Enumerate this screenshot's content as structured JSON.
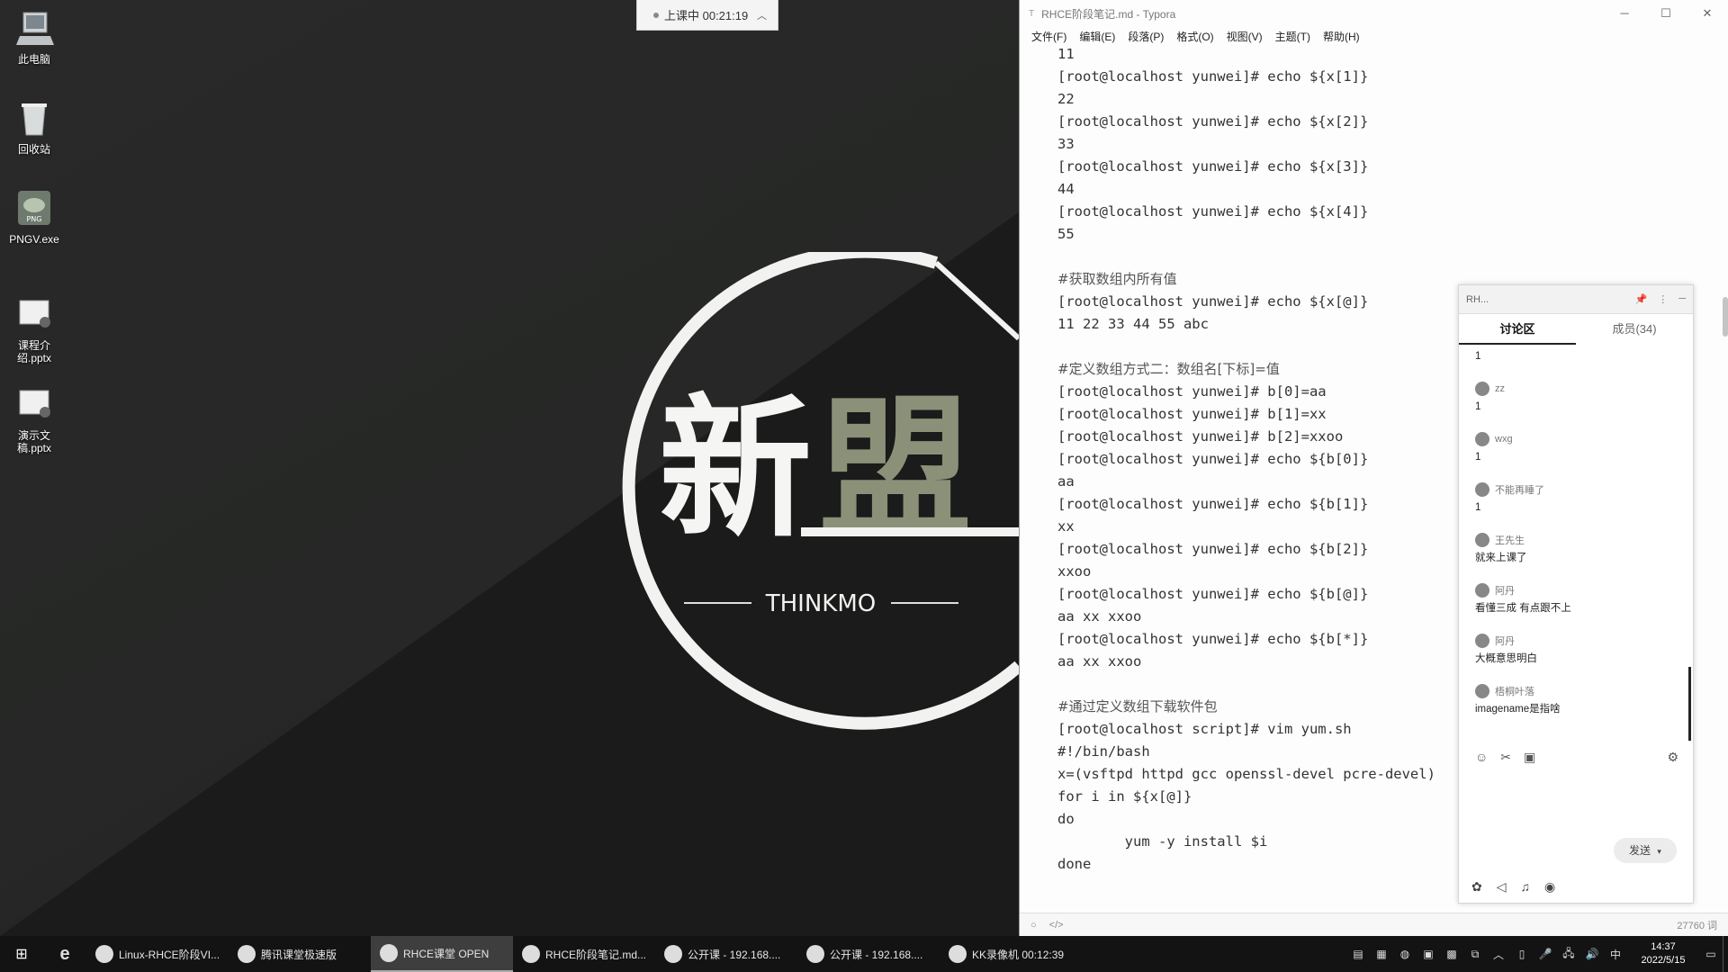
{
  "desktop": {
    "icons": [
      {
        "label": "此电脑",
        "icon": "computer-icon"
      },
      {
        "label": "回收站",
        "icon": "recycle-bin-icon"
      },
      {
        "label": "PNGV.exe",
        "icon": "png-viewer-icon"
      },
      {
        "label": "课程介绍.pptx",
        "icon": "pptx-file-icon"
      },
      {
        "label": "演示文稿.pptx",
        "icon": "pptx-file-icon"
      }
    ],
    "logo": {
      "chars": "新盟",
      "caption": "THINKMO"
    }
  },
  "class_status": {
    "label": "上课中 00:21:19"
  },
  "typora": {
    "title": "RHCE阶段笔记.md - Typora",
    "menu": [
      "文件(F)",
      "编辑(E)",
      "段落(P)",
      "格式(O)",
      "视图(V)",
      "主题(T)",
      "帮助(H)"
    ],
    "lines": [
      "11",
      "[root@localhost yunwei]# echo ${x[1]}",
      "22",
      "[root@localhost yunwei]# echo ${x[2]}",
      "33",
      "[root@localhost yunwei]# echo ${x[3]}",
      "44",
      "[root@localhost yunwei]# echo ${x[4]}",
      "55",
      "",
      "#获取数组内所有值",
      "[root@localhost yunwei]# echo ${x[@]}",
      "11 22 33 44 55 abc",
      "",
      "#定义数组方式二：数组名[下标]=值",
      "[root@localhost yunwei]# b[0]=aa",
      "[root@localhost yunwei]# b[1]=xx",
      "[root@localhost yunwei]# b[2]=xxoo",
      "[root@localhost yunwei]# echo ${b[0]}",
      "aa",
      "[root@localhost yunwei]# echo ${b[1]}",
      "xx",
      "[root@localhost yunwei]# echo ${b[2]}",
      "xxoo",
      "[root@localhost yunwei]# echo ${b[@]}",
      "aa xx xxoo",
      "[root@localhost yunwei]# echo ${b[*]}",
      "aa xx xxoo",
      "",
      "#通过定义数组下载软件包",
      "[root@localhost script]# vim yum.sh",
      "#!/bin/bash",
      "x=(vsftpd httpd gcc openssl-devel pcre-devel)",
      "for i in ${x[@]}",
      "do",
      "        yum -y install $i",
      "done"
    ],
    "status_right": "27760 词"
  },
  "chat": {
    "title": "RH...",
    "tabs": [
      "讨论区",
      "成员(34)"
    ],
    "messages": [
      {
        "user": "",
        "text": "1"
      },
      {
        "user": "zz",
        "text": "1"
      },
      {
        "user": "wxg",
        "text": "1"
      },
      {
        "user": "不能再睡了",
        "text": "1"
      },
      {
        "user": "王先生",
        "text": "就来上课了"
      },
      {
        "user": "阿丹",
        "text": "看懂三成 有点跟不上"
      },
      {
        "user": "阿丹",
        "text": "大概意思明白"
      },
      {
        "user": "梧桐叶落",
        "text": "imagename是指啥"
      }
    ],
    "send_label": "发送"
  },
  "taskbar": {
    "items": [
      {
        "label": "Linux-RHCE阶段VI...",
        "active": false
      },
      {
        "label": "腾讯课堂极速版",
        "active": false
      },
      {
        "label": "RHCE课堂 OPEN",
        "active": true
      },
      {
        "label": "RHCE阶段笔记.md...",
        "active": false
      },
      {
        "label": "公开课 - 192.168....",
        "active": false
      },
      {
        "label": "公开课 - 192.168....",
        "active": false
      },
      {
        "label": "KK录像机 00:12:39",
        "active": false
      }
    ],
    "ime": "中",
    "time": "14:37",
    "date": "2022/5/15"
  }
}
